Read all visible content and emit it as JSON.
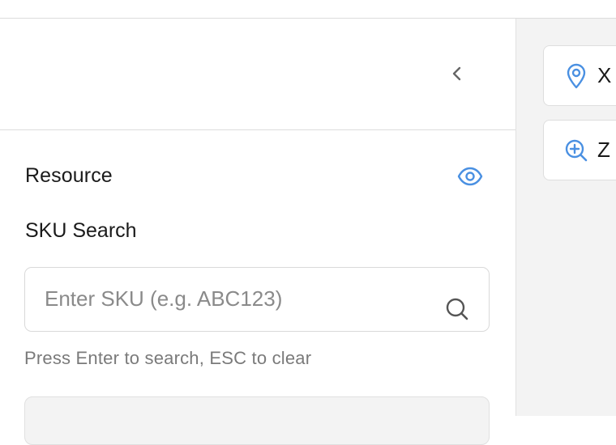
{
  "panel": {
    "section_title": "Resource",
    "sku_label": "SKU Search",
    "sku_placeholder": "Enter SKU (e.g. ABC123)",
    "sku_value": "",
    "hint": "Press Enter to search, ESC to clear"
  },
  "toolbar": {
    "items": [
      {
        "icon": "location-pin-icon",
        "label": "X"
      },
      {
        "icon": "zoom-in-icon",
        "label": "Z"
      }
    ]
  },
  "colors": {
    "accent": "#4a90e2",
    "muted_text": "#7a7a7a",
    "panel_bg": "#f3f3f3"
  }
}
